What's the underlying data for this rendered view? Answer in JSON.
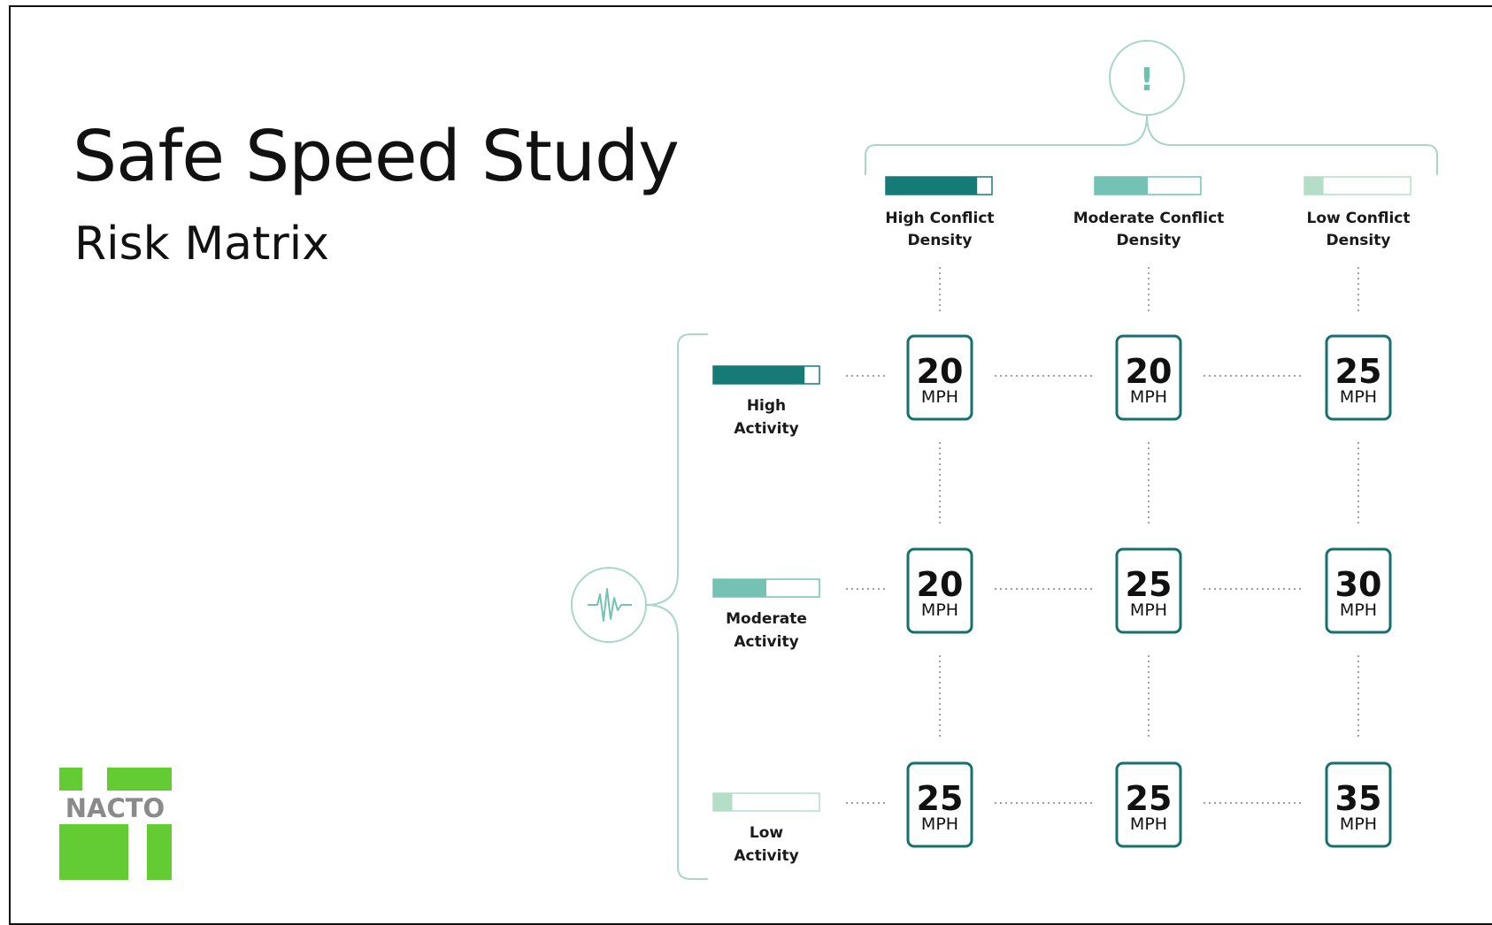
{
  "header": {
    "title": "Safe Speed Study",
    "subtitle": "Risk Matrix"
  },
  "logo": {
    "text": "NACTO"
  },
  "colors": {
    "high": "#167b77",
    "moderate": "#73c2b3",
    "low": "#b4dec8",
    "line": "#a9d6cb",
    "sign_border": "#16706c",
    "logo_green": "#63cc32"
  },
  "columns": [
    {
      "line1": "High Conflict",
      "line2": "Density",
      "level": 0.86
    },
    {
      "line1": "Moderate Conflict",
      "line2": "Density",
      "level": 0.5
    },
    {
      "line1": "Low Conflict",
      "line2": "Density",
      "level": 0.18
    }
  ],
  "rows": [
    {
      "line1": "High",
      "line2": "Activity",
      "level": 0.86
    },
    {
      "line1": "Moderate",
      "line2": "Activity",
      "level": 0.5
    },
    {
      "line1": "Low",
      "line2": "Activity",
      "level": 0.18
    }
  ],
  "matrix": [
    [
      {
        "value": "20",
        "unit": "MPH"
      },
      {
        "value": "20",
        "unit": "MPH"
      },
      {
        "value": "25",
        "unit": "MPH"
      }
    ],
    [
      {
        "value": "20",
        "unit": "MPH"
      },
      {
        "value": "25",
        "unit": "MPH"
      },
      {
        "value": "30",
        "unit": "MPH"
      }
    ],
    [
      {
        "value": "25",
        "unit": "MPH"
      },
      {
        "value": "25",
        "unit": "MPH"
      },
      {
        "value": "35",
        "unit": "MPH"
      }
    ]
  ],
  "icons": {
    "conflict": "exclamation-icon",
    "activity": "activity-wave-icon",
    "exclamation_glyph": "!"
  }
}
